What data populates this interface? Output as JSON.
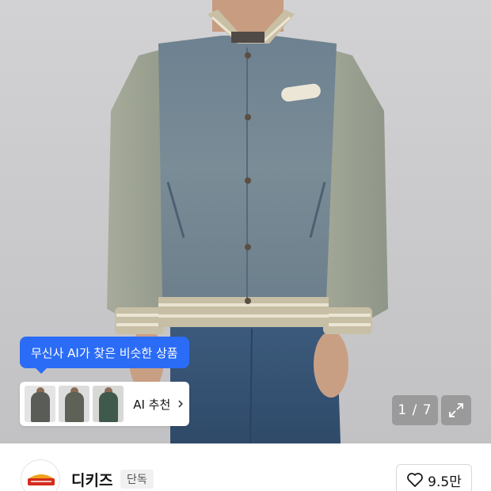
{
  "ai_tooltip": {
    "text": "무신사 AI가 찾은 비슷한 상품"
  },
  "ai_recommend": {
    "label": "AI 추천"
  },
  "gallery": {
    "counter": "1 / 7"
  },
  "brand": {
    "name": "디키즈",
    "badge": "단독",
    "logo_text": "Dickies"
  },
  "like": {
    "count": "9.5만"
  },
  "colors": {
    "accent": "#2b6cf6",
    "denim": "#5d7484",
    "rib": "#c9bfa5"
  },
  "icons": [
    "heart-icon",
    "expand-icon",
    "chevron-right-icon"
  ]
}
